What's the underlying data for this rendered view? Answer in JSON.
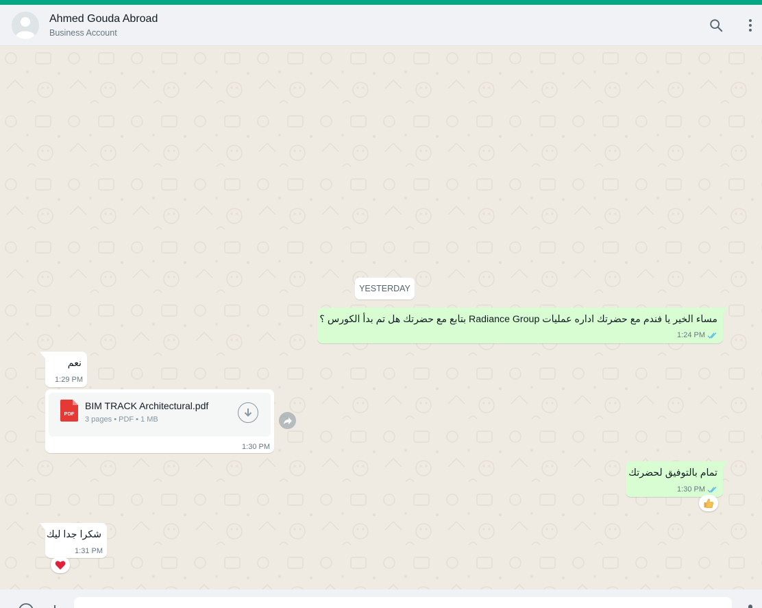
{
  "header": {
    "contact_name": "Ahmed Gouda Abroad",
    "contact_subtitle": "Business Account",
    "search_icon": "search-icon",
    "menu_icon": "kebab-menu-icon"
  },
  "chat": {
    "date_separator": "YESTERDAY",
    "messages": [
      {
        "direction": "outgoing",
        "text": "مساء الخير  يا فندم مع حضرتك اداره عمليات Radiance Group  بتابع مع حضرتك  هل تم بدأ الكورس ؟",
        "time": "1:24 PM",
        "status": "read"
      },
      {
        "direction": "incoming",
        "text": "نعم",
        "time": "1:29 PM"
      },
      {
        "direction": "incoming",
        "type": "document",
        "file_name": "BIM TRACK Architectural.pdf",
        "file_info": "3 pages • PDF • 1 MB",
        "file_badge": "PDF",
        "time": "1:30 PM"
      },
      {
        "direction": "outgoing",
        "text": "تمام بالتوفيق لحضرتك",
        "time": "1:30 PM",
        "status": "read",
        "reaction": "thumbs-up"
      },
      {
        "direction": "incoming",
        "text": "شكرا جدا ليك",
        "time": "1:31 PM",
        "reaction": "red-heart"
      }
    ]
  },
  "composer": {
    "value": "",
    "emoji_icon": "emoji-icon",
    "attach_icon": "plus-icon",
    "mic_icon": "microphone-icon"
  },
  "colors": {
    "accent": "#00a884",
    "outgoing_bubble": "#d9fdd3",
    "incoming_bubble": "#ffffff",
    "read_ticks": "#53bdeb",
    "pdf_red": "#e53935"
  }
}
